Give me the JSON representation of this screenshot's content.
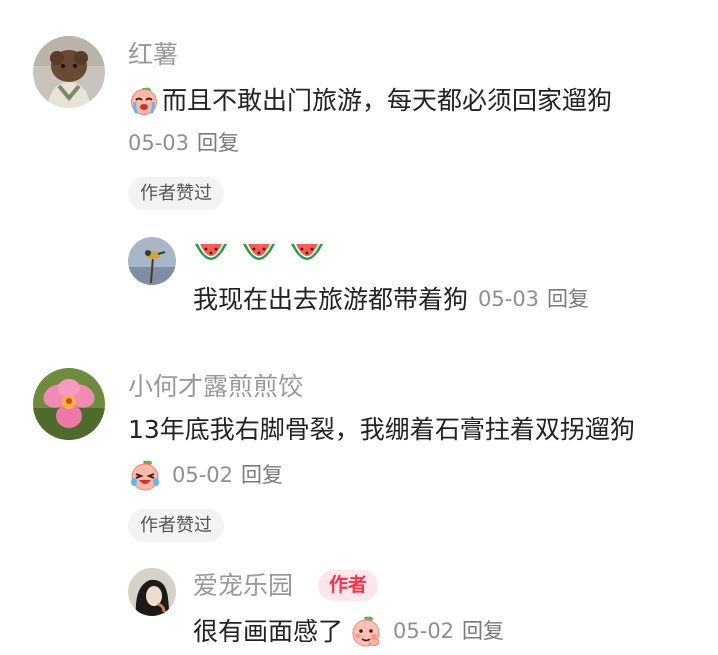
{
  "comments": [
    {
      "user": "红薯",
      "text": "而且不敢出门旅游，每天都必须回家遛狗",
      "date": "05-03",
      "reply_label": "回复",
      "author_liked": "作者赞过",
      "avatar_icon": "dog-avatar",
      "reply": {
        "emoji_row_icon": "watermelon-icon",
        "text": "我现在出去旅游都带着狗",
        "date": "05-03",
        "reply_label": "回复",
        "avatar_icon": "bird-avatar"
      }
    },
    {
      "user": "小何才露煎煎饺",
      "text": "13年底我右脚骨裂，我绷着石膏拄着双拐遛狗",
      "date": "05-02",
      "reply_label": "回复",
      "author_liked": "作者赞过",
      "avatar_icon": "orchid-avatar",
      "reply": {
        "user": "爱宠乐园",
        "badge": "作者",
        "text": "很有画面感了",
        "date": "05-02",
        "reply_label": "回复",
        "avatar_icon": "girl-avatar"
      }
    }
  ],
  "colors": {
    "name": "#999999",
    "text": "#222222",
    "badge_bg": "#ffe6ea",
    "badge_text": "#f0344d",
    "pill_bg": "#f3f3f3"
  }
}
